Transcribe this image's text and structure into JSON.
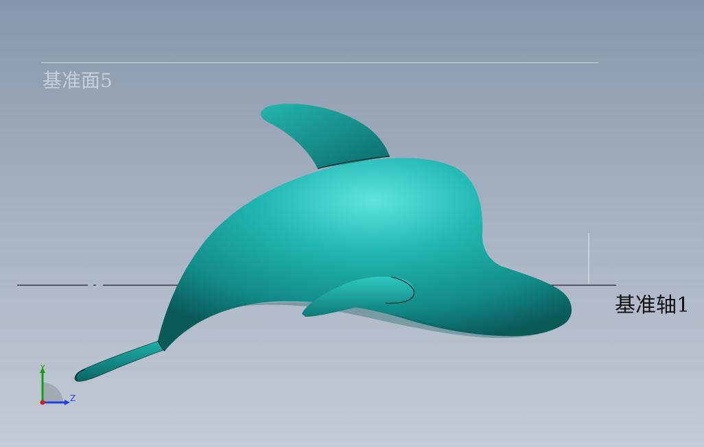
{
  "viewport": {
    "plane_label": "基准面5",
    "axis_label": "基准轴1",
    "model_color": "#1aa7a2",
    "model_highlight": "#5fe3e0",
    "model_shadow": "#0a5a58",
    "background_top": "#8796ab",
    "background_bottom": "#c4cbd6"
  },
  "triad": {
    "y_label": "Y",
    "z_label": "Z",
    "y_color": "#10a010",
    "z_color": "#2040e0",
    "x_color": "#d02020"
  }
}
